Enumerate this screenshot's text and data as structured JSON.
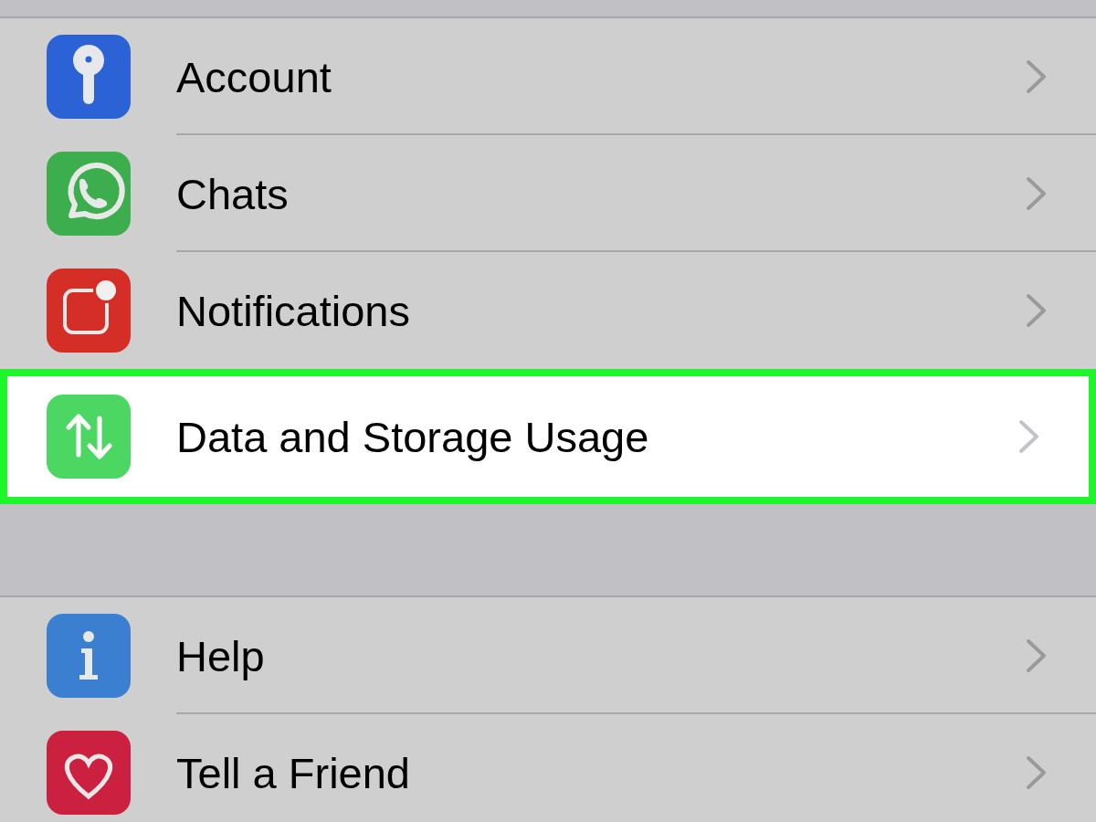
{
  "sections": [
    {
      "items": [
        {
          "label": "Account",
          "kind": "key",
          "color": "#2b62d6",
          "selected": false
        },
        {
          "label": "Chats",
          "kind": "chat",
          "color": "#3cae4d",
          "selected": false
        },
        {
          "label": "Notifications",
          "kind": "notification",
          "color": "#d42e26",
          "selected": false
        },
        {
          "label": "Data and Storage Usage",
          "kind": "arrows",
          "color": "#4cd763",
          "selected": true
        }
      ]
    },
    {
      "items": [
        {
          "label": "Help",
          "kind": "info",
          "color": "#3a7fd0",
          "selected": false
        },
        {
          "label": "Tell a Friend",
          "kind": "heart",
          "color": "#cc2040",
          "selected": false
        }
      ]
    }
  ]
}
